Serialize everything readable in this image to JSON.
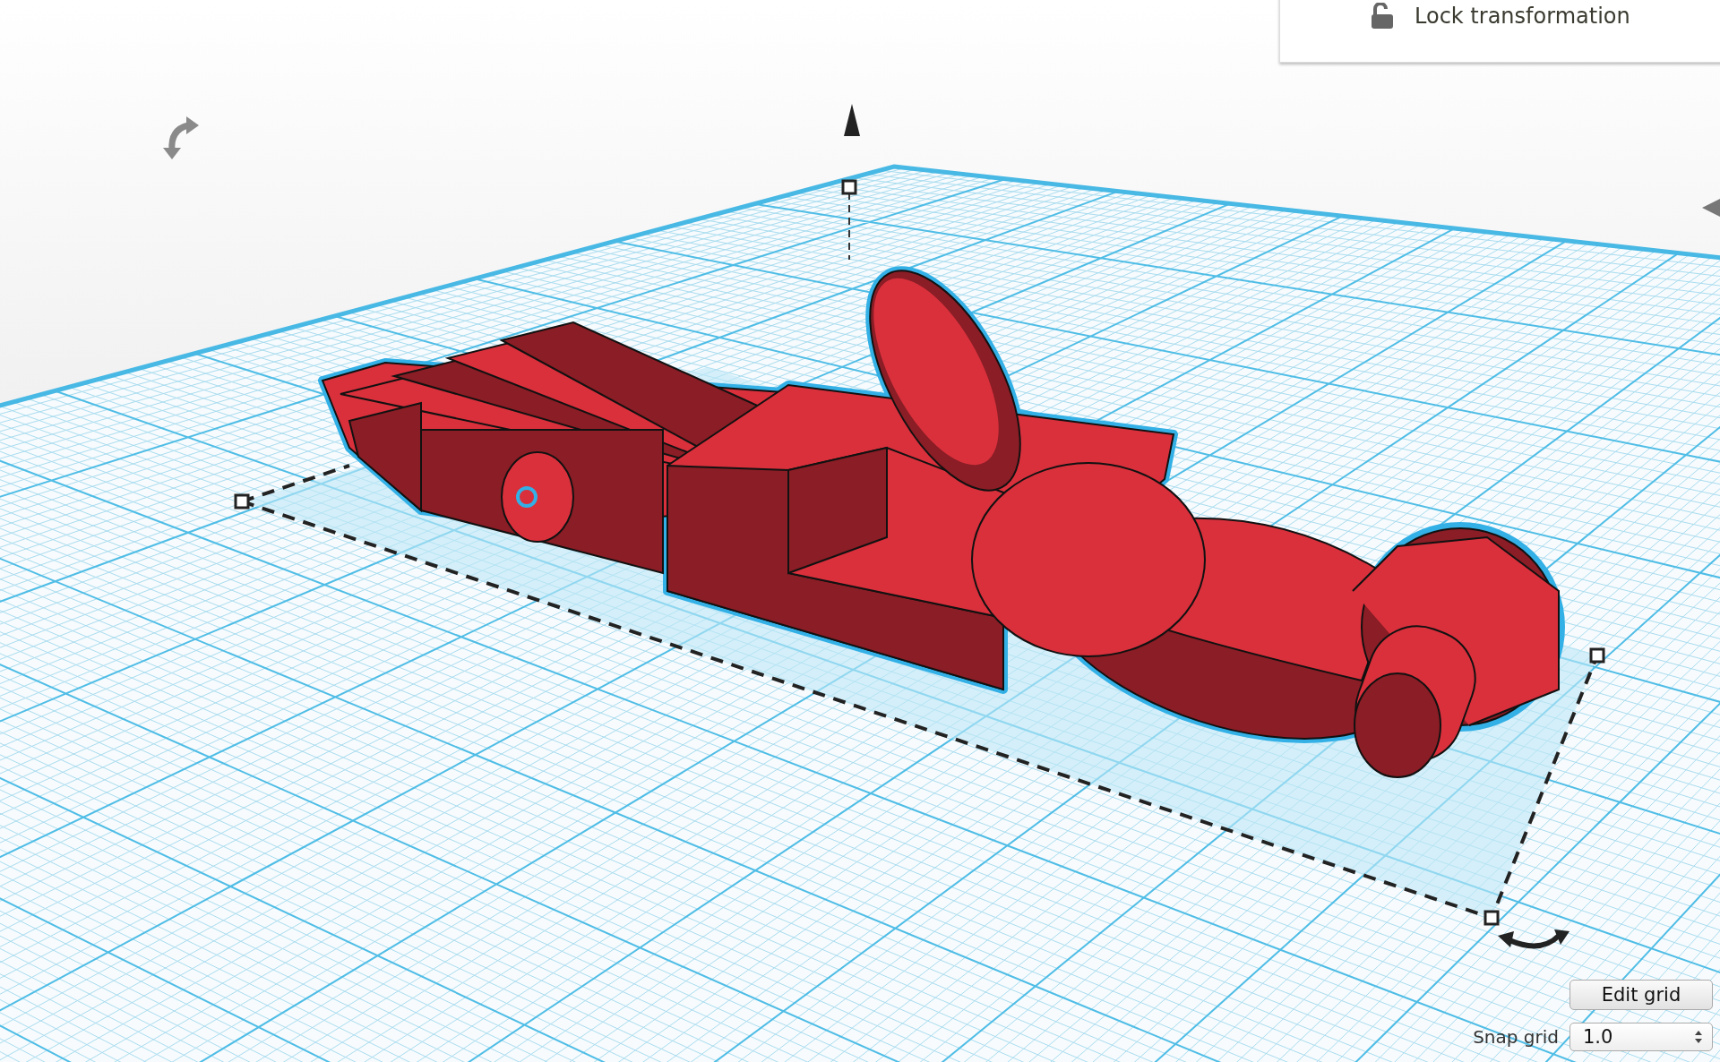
{
  "transform_panel": {
    "lock_label": "Lock transformation",
    "locked": false
  },
  "grid_controls": {
    "edit_button": "Edit grid",
    "snap_label": "Snap grid",
    "snap_value": "1.0"
  }
}
